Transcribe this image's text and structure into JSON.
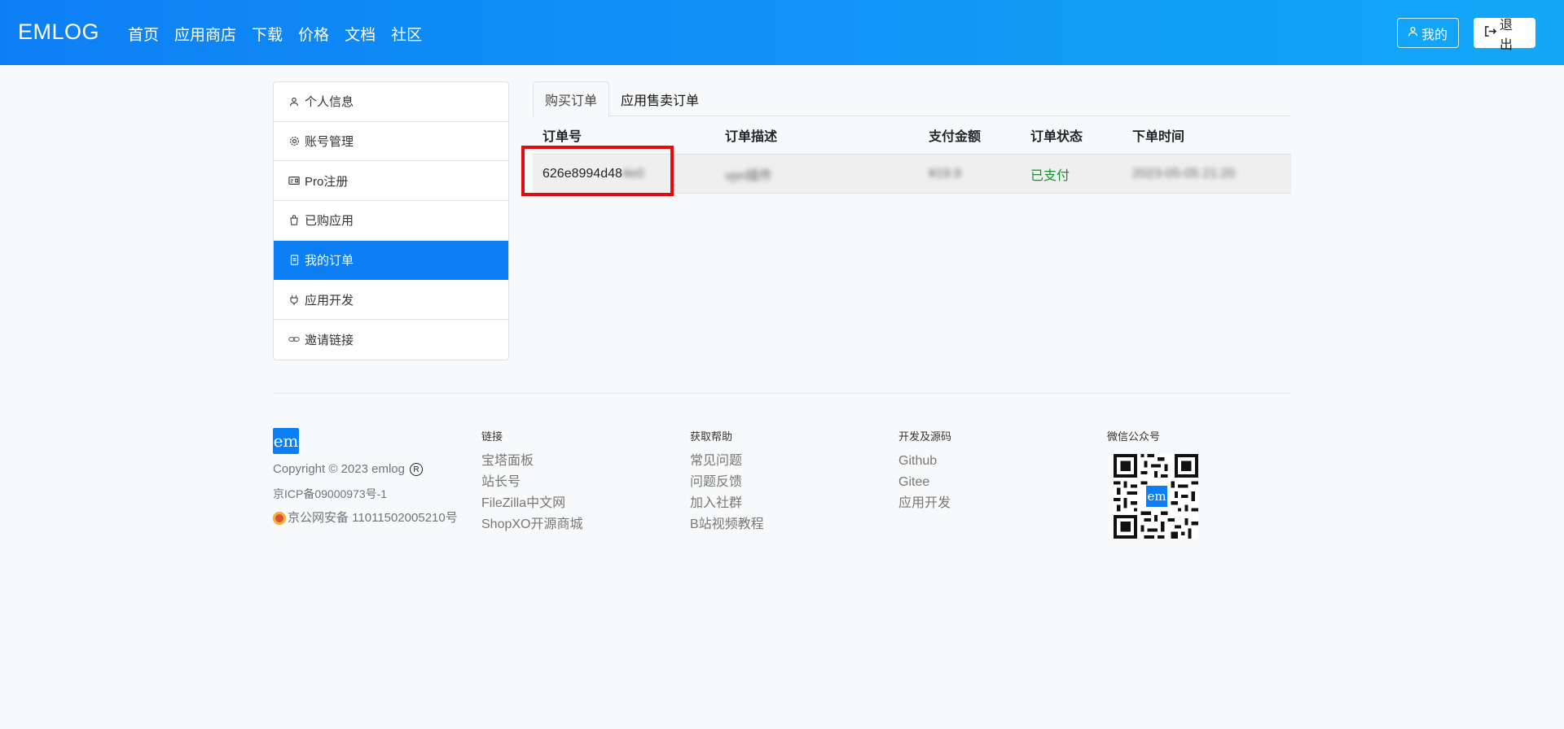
{
  "navbar": {
    "brand": "EMLOG",
    "links": [
      "首页",
      "应用商店",
      "下载",
      "价格",
      "文档",
      "社区"
    ],
    "mine_label": "我的",
    "logout_label": "退出"
  },
  "sidebar": {
    "items": [
      {
        "label": "个人信息",
        "icon": "user-icon"
      },
      {
        "label": "账号管理",
        "icon": "gear-icon"
      },
      {
        "label": "Pro注册",
        "icon": "card-icon"
      },
      {
        "label": "已购应用",
        "icon": "bag-icon"
      },
      {
        "label": "我的订单",
        "icon": "receipt-icon",
        "active": true
      },
      {
        "label": "应用开发",
        "icon": "plug-icon"
      },
      {
        "label": "邀请链接",
        "icon": "link-icon"
      }
    ]
  },
  "tabs": [
    "购买订单",
    "应用售卖订单"
  ],
  "table": {
    "headers": [
      "订单号",
      "订单描述",
      "支付金额",
      "订单状态",
      "下单时间"
    ],
    "rows": [
      {
        "order_no": "626e8994d48",
        "order_no_blurred": "4e0",
        "description": "vpn插件",
        "amount": "¥19.9",
        "status": "已支付",
        "time": "2023-05-05 21:20"
      }
    ]
  },
  "footer": {
    "logo_text": "em",
    "copyright": "Copyright © 2023 emlog",
    "reg_mark": "R",
    "icp": "京ICP备09000973号-1",
    "police": "京公网安备 11011502005210号",
    "columns": [
      {
        "title": "链接",
        "links": [
          "宝塔面板",
          "站长号",
          "FileZilla中文网",
          "ShopXO开源商城"
        ]
      },
      {
        "title": "获取帮助",
        "links": [
          "常见问题",
          "问题反馈",
          "加入社群",
          "B站视频教程"
        ]
      },
      {
        "title": "开发及源码",
        "links": [
          "Github",
          "Gitee",
          "应用开发"
        ]
      }
    ],
    "wechat_title": "微信公众号",
    "qr_logo": "em"
  },
  "colors": {
    "primary": "#0d7ff5",
    "paid": "#1a8f2e",
    "highlight": "#e30b0b"
  }
}
